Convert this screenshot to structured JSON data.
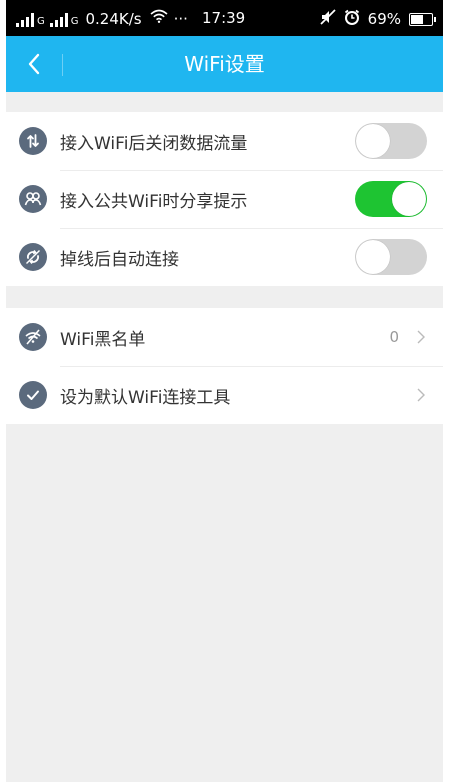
{
  "status_bar": {
    "net_type_1": "G",
    "net_type_2": "G",
    "speed": "0.24K/s",
    "dots": "···",
    "time": "17:39",
    "battery": "69%",
    "battery_level": 0.69
  },
  "title_bar": {
    "title": "WiFi设置",
    "back_icon": "chevron-left-icon"
  },
  "settings_group_1": {
    "items": [
      {
        "label": "接入WiFi后关闭数据流量",
        "icon": "data-switch-icon",
        "toggle": "off"
      },
      {
        "label": "接入公共WiFi时分享提示",
        "icon": "share-people-icon",
        "toggle": "on"
      },
      {
        "label": "掉线后自动连接",
        "icon": "reconnect-icon",
        "toggle": "off"
      }
    ]
  },
  "settings_group_2": {
    "items": [
      {
        "label": "WiFi黑名单",
        "icon": "wifi-blocked-icon",
        "count": "0"
      },
      {
        "label": "设为默认WiFi连接工具",
        "icon": "check-icon"
      }
    ]
  },
  "colors": {
    "header": "#1fb6f0",
    "toggle_on": "#1ec432",
    "toggle_off": "#d3d3d3",
    "icon_bg": "#5b6a7d",
    "background": "#efefef"
  }
}
